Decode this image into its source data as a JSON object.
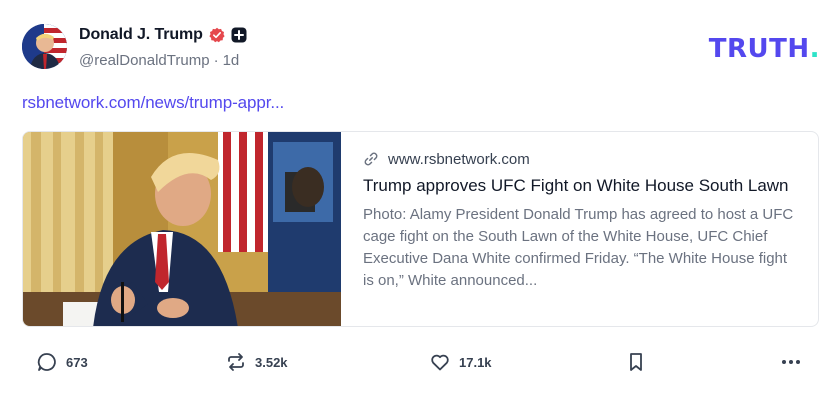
{
  "author": {
    "display_name": "Donald J. Trump",
    "handle": "@realDonaldTrump",
    "separator": "·",
    "time_ago": "1d",
    "avatar_icon": "avatar-image",
    "verified_icon": "verified-badge-icon",
    "extra_badge_icon": "plus-badge-icon"
  },
  "logo": {
    "text": "TRUTH",
    "dot": ".",
    "color": "#5448ee",
    "dot_color": "#2ee3c8"
  },
  "post": {
    "link_text": "rsbnetwork.com/news/trump-appr..."
  },
  "card": {
    "domain": "www.rsbnetwork.com",
    "title": "Trump approves UFC Fight on White House South Lawn",
    "description": "Photo: Alamy President Donald Trump has agreed to host a UFC cage fight on the South Lawn of the White House, UFC Chief Executive Dana White confirmed Friday. “The White House fight is on,” White announced...",
    "image_icon": "article-photo"
  },
  "actions": {
    "replies": "673",
    "retruths": "3.52k",
    "likes": "17.1k",
    "reply_icon": "comment-icon",
    "retruth_icon": "retruth-icon",
    "like_icon": "heart-icon",
    "bookmark_icon": "bookmark-icon",
    "more_icon": "more-icon"
  },
  "colors": {
    "accent": "#5448ee",
    "verified": "#e5484d",
    "muted_text": "#6b7280"
  }
}
